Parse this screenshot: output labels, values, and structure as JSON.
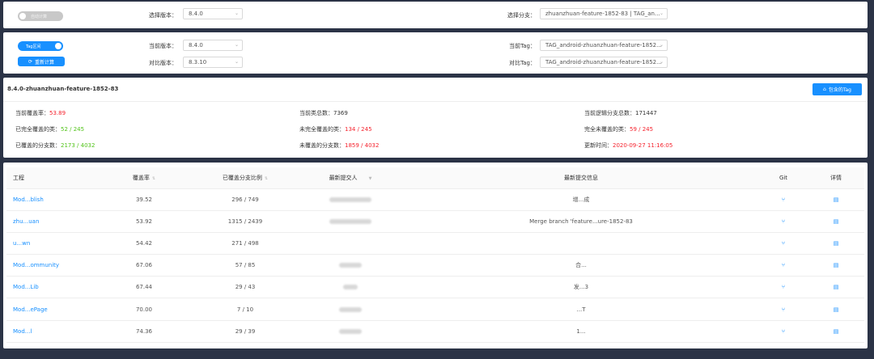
{
  "panel1": {
    "toggle_label": "自动计算",
    "version_label": "选择版本：",
    "version_value": "8.4.0",
    "branch_label": "选择分支：",
    "branch_value": "zhuanzhuan-feature-1852-83 | TAG_an..."
  },
  "panel2": {
    "toggle_label": "Tag区间",
    "recalc_label": "重新计算",
    "current_version_label": "当前版本：",
    "current_version_value": "8.4.0",
    "compare_version_label": "对比版本：",
    "compare_version_value": "8.3.10",
    "current_tag_label": "当前Tag：",
    "current_tag_value": "TAG_android-zhuanzhuan-feature-1852...",
    "compare_tag_label": "对比Tag：",
    "compare_tag_value": "TAG_android-zhuanzhuan-feature-1852..."
  },
  "panel3": {
    "title": "8.4.0-zhuanzhuan-feature-1852-83",
    "tag_button": "包含的Tag",
    "stats": {
      "coverage_label": "当前覆盖率：",
      "coverage_value": "53.89",
      "class_total_label": "当前类总数：",
      "class_total_value": "7369",
      "branch_total_label": "当前逻辑分支总数：",
      "branch_total_value": "171447",
      "full_covered_label": "已完全覆盖的类：",
      "full_covered_value": "52 / 245",
      "not_full_covered_label": "未完全覆盖的类：",
      "not_full_covered_value": "134 / 245",
      "full_uncovered_label": "完全未覆盖的类：",
      "full_uncovered_value": "59 / 245",
      "covered_branch_label": "已覆盖的分支数：",
      "covered_branch_value": "2173 / 4032",
      "uncovered_branch_label": "未覆盖的分支数：",
      "uncovered_branch_value": "1859 / 4032",
      "updated_label": "更新时间：",
      "updated_value": "2020-09-27 11:16:05"
    }
  },
  "table": {
    "headers": {
      "project": "工程",
      "coverage": "覆盖率",
      "branch_ratio": "已覆盖分支比例",
      "committer": "最新提交人",
      "commit_msg": "最新提交信息",
      "git": "Git",
      "detail": "详情"
    },
    "rows": [
      {
        "project": "Mod...blish",
        "coverage": "39.52",
        "ratio": "296 / 749",
        "commit_msg": "增...成"
      },
      {
        "project": "zhu...uan",
        "coverage": "53.92",
        "ratio": "1315 / 2439",
        "commit_msg": "Merge branch 'feature...ure-1852-83"
      },
      {
        "project": "u...wn",
        "coverage": "54.42",
        "ratio": "271 / 498",
        "commit_msg": ""
      },
      {
        "project": "Mod...ommunity",
        "coverage": "67.06",
        "ratio": "57 / 85",
        "commit_msg": "合..."
      },
      {
        "project": "Mod...Lib",
        "coverage": "67.44",
        "ratio": "29 / 43",
        "commit_msg": "发...3"
      },
      {
        "project": "Mod...ePage",
        "coverage": "70.00",
        "ratio": "7 / 10",
        "commit_msg": "...T"
      },
      {
        "project": "Mod...l",
        "coverage": "74.36",
        "ratio": "29 / 39",
        "commit_msg": "1..."
      }
    ]
  },
  "icons": {
    "git": "git-branch-icon",
    "detail": "file-icon",
    "sort": "sort-icon",
    "filter": "filter-icon",
    "chevron": "chevron-down-icon",
    "refresh": "refresh-icon",
    "tag": "tag-icon"
  },
  "colors": {
    "primary": "#1890ff",
    "danger": "#f5222d",
    "success": "#52c41a",
    "background": "#2b3346"
  }
}
